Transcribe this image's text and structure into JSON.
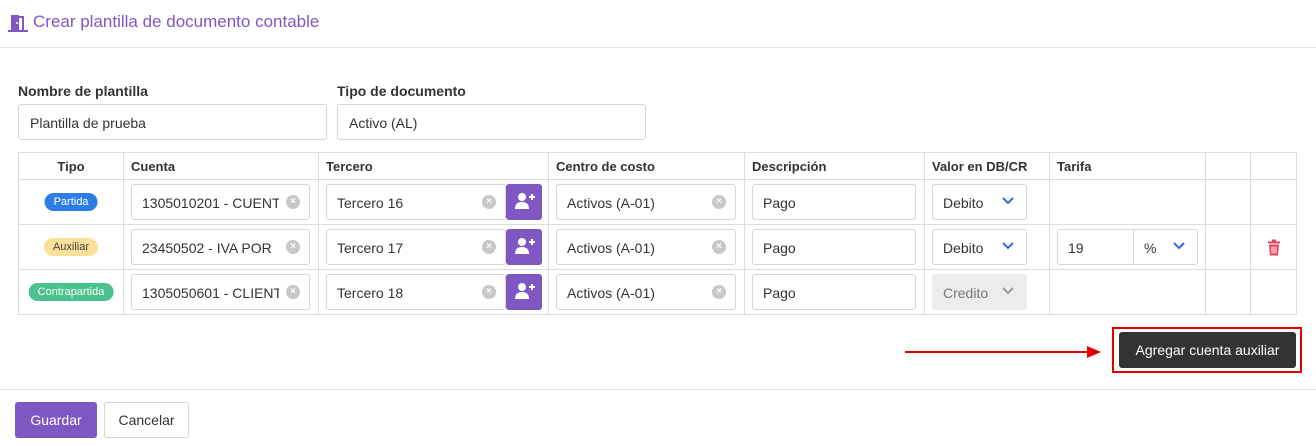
{
  "header": {
    "title": "Crear plantilla de documento contable"
  },
  "form": {
    "name_label": "Nombre de plantilla",
    "name_value": "Plantilla de prueba",
    "type_label": "Tipo de documento",
    "type_value": "Activo (AL)"
  },
  "table": {
    "columns": [
      "Tipo",
      "Cuenta",
      "Tercero",
      "Centro de costo",
      "Descripción",
      "Valor en DB/CR",
      "Tarifa",
      "",
      ""
    ],
    "rows": [
      {
        "tipo": "Partida",
        "cuenta": "1305010201 - CUENT",
        "tercero": "Tercero 16",
        "centro": "Activos (A-01)",
        "descripcion": "Pago",
        "valor": "Debito"
      },
      {
        "tipo": "Auxiliar",
        "cuenta": "23450502 - IVA POR",
        "tercero": "Tercero 17",
        "centro": "Activos (A-01)",
        "descripcion": "Pago",
        "valor": "Debito",
        "tarifa_value": "19",
        "tarifa_unit": "%"
      },
      {
        "tipo": "Contrapartida",
        "cuenta": "1305050601 - CLIENT",
        "tercero": "Tercero 18",
        "centro": "Activos (A-01)",
        "descripcion": "Pago",
        "valor": "Credito"
      }
    ]
  },
  "actions": {
    "add_aux_label": "Agregar cuenta auxiliar"
  },
  "footer": {
    "save_label": "Guardar",
    "cancel_label": "Cancelar"
  },
  "colors": {
    "accent": "#7e57c2",
    "partida": "#2d7de6",
    "auxiliar": "#fbe09a",
    "contrapartida": "#4bc28d",
    "delete": "#e0455a",
    "highlight": "#e00000"
  },
  "icons": {
    "header": "door-icon",
    "add_tercero": "add-user-icon",
    "delete": "trash-icon",
    "dropdown": "chevron-down-icon",
    "clear": "clear-icon"
  }
}
